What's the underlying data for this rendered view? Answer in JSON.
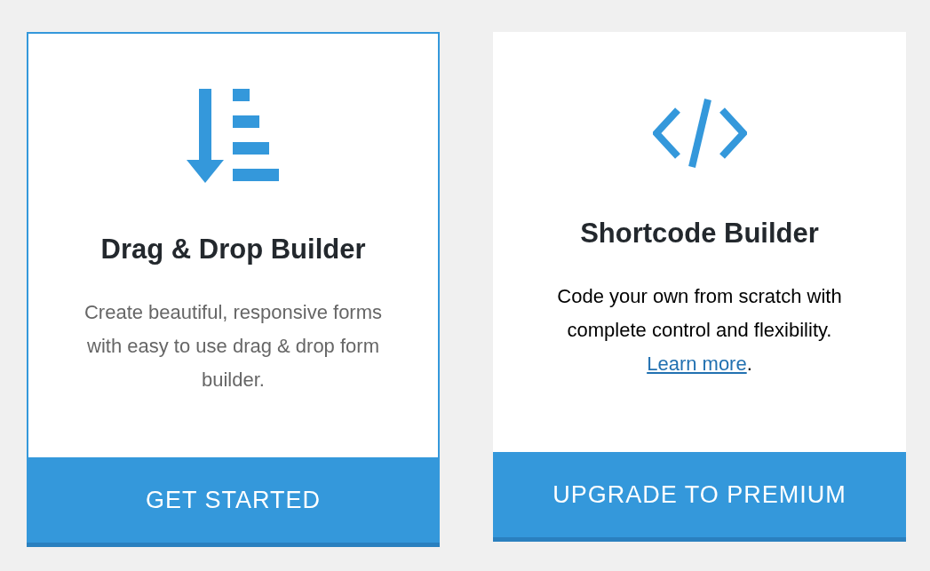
{
  "cards": [
    {
      "kind": "drag-drop",
      "title": "Drag & Drop Builder",
      "description": "Create beautiful, responsive forms with easy to use drag & drop form builder.",
      "selected": true,
      "button": "GET STARTED"
    },
    {
      "kind": "code",
      "title": "Shortcode Builder",
      "description": "Code your own from scratch with complete control and flexibility.",
      "link": "Learn more",
      "link_suffix": ".",
      "selected": false,
      "button": "UPGRADE TO PREMIUM"
    }
  ]
}
